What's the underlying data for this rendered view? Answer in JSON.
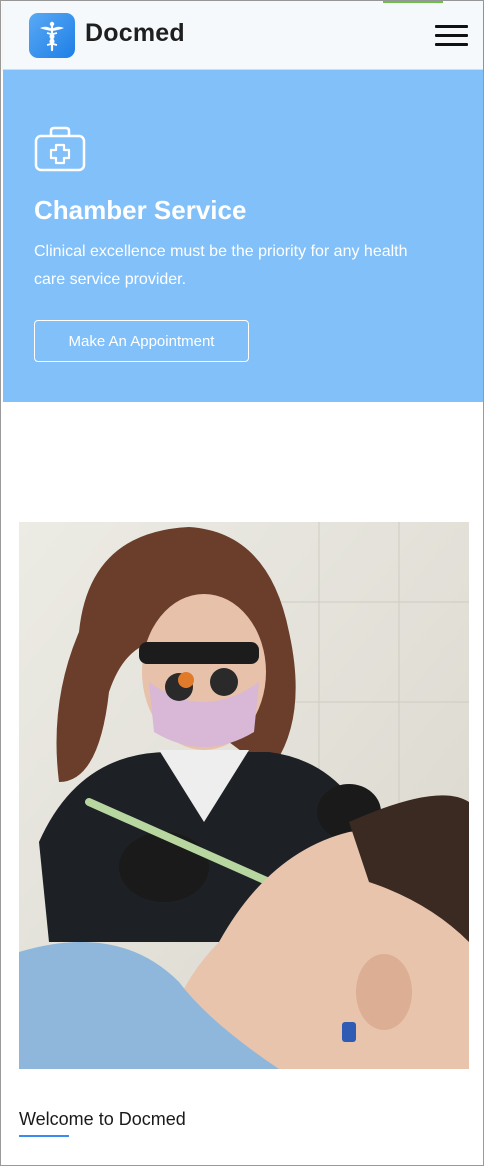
{
  "header": {
    "brand": "Docmed",
    "logo_icon": "caduceus-icon",
    "menu_icon": "hamburger-menu-icon"
  },
  "hero": {
    "icon": "medical-kit-icon",
    "title": "Chamber Service",
    "description": "Clinical excellence must be the priority for any health care service provider.",
    "button_label": "Make An Appointment",
    "background": "#82c0fa"
  },
  "photo": {
    "icon": "dentist-treating-patient-photo"
  },
  "welcome": {
    "title": "Welcome to Docmed",
    "accent": "#3c8cf0"
  }
}
